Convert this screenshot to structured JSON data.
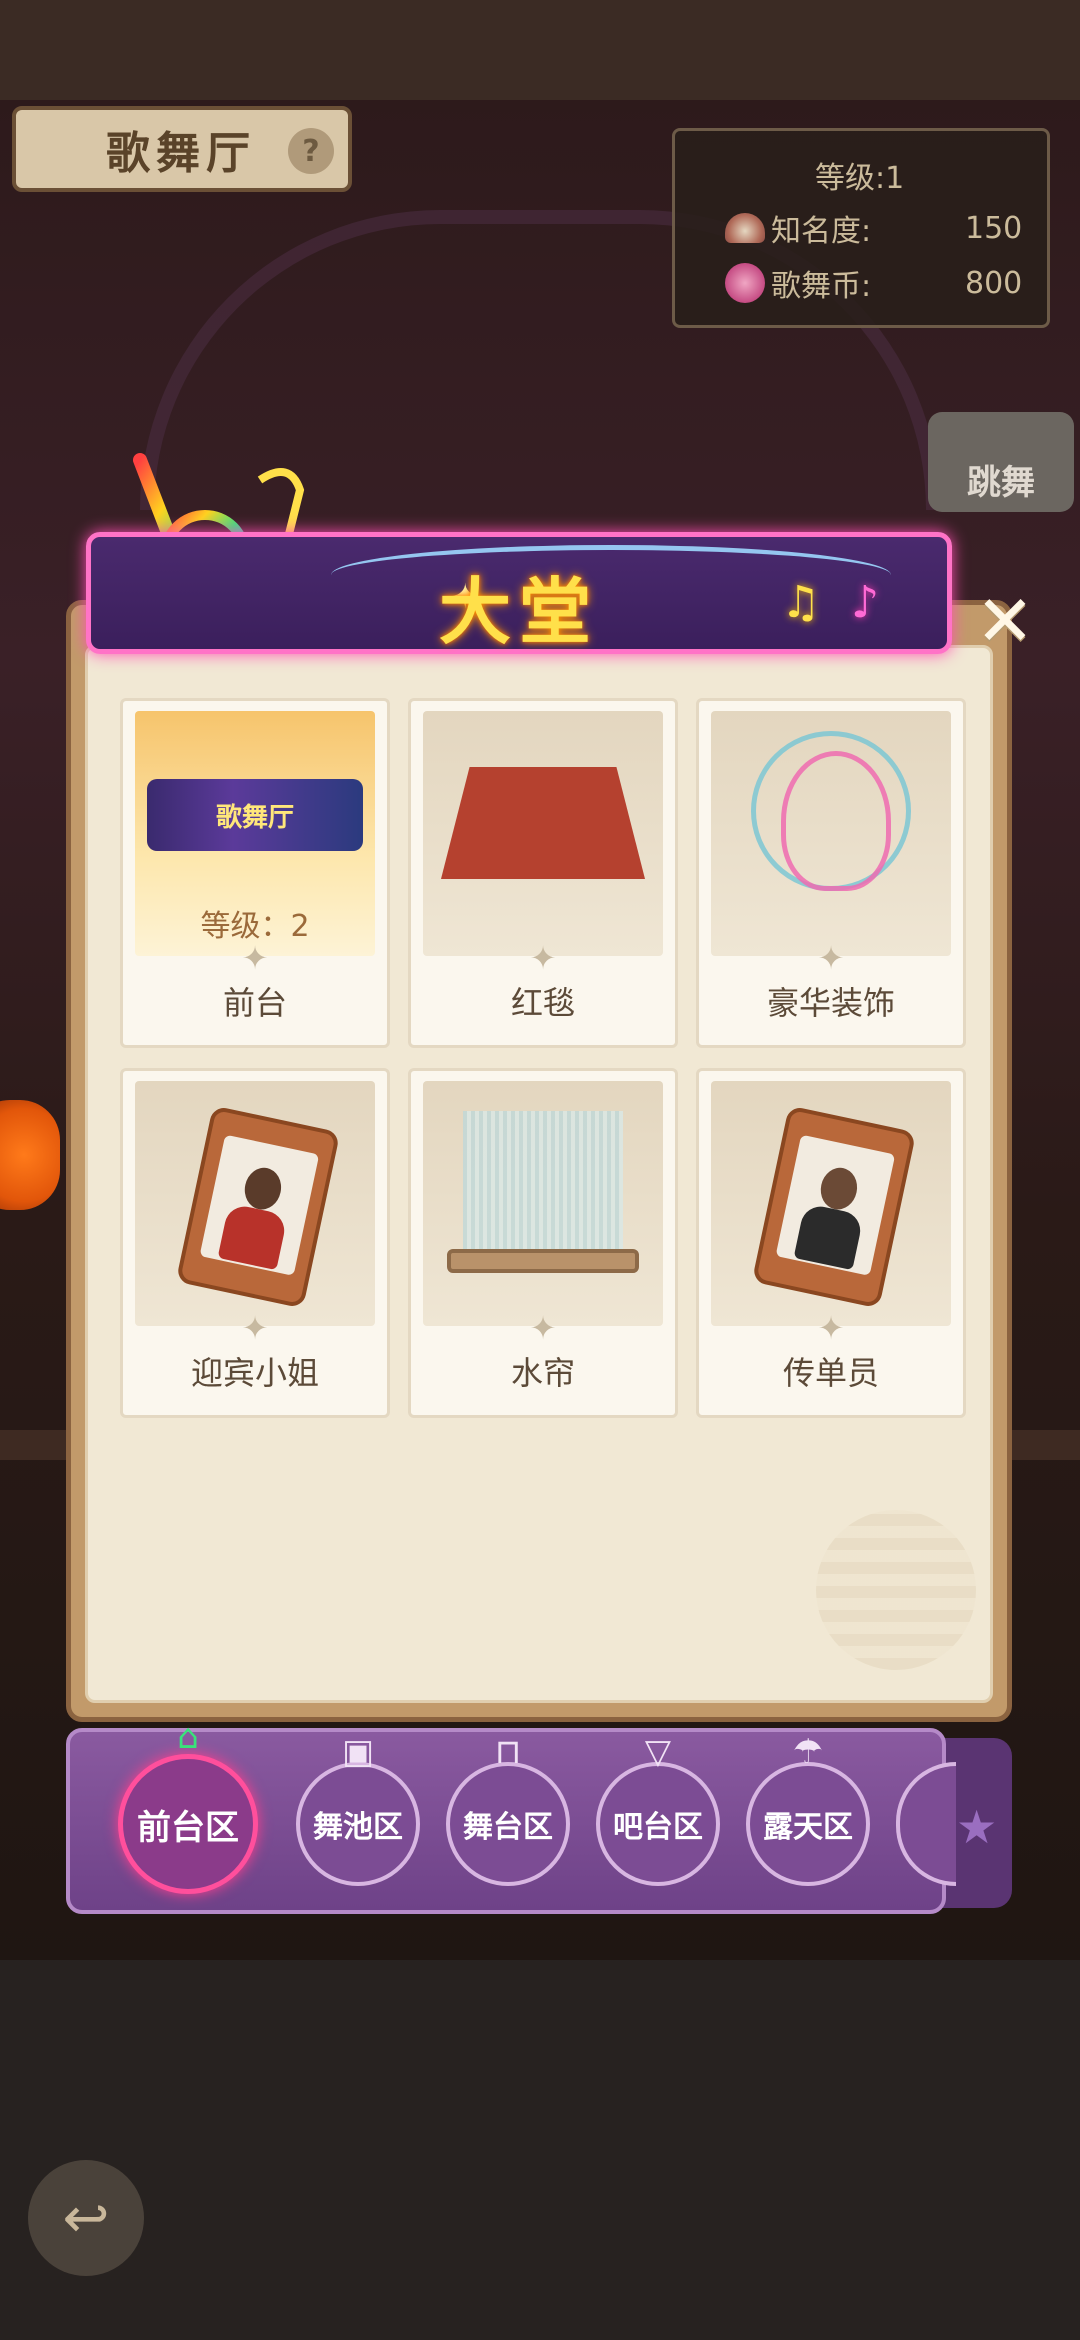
{
  "venue": {
    "title": "歌舞厅"
  },
  "stats": {
    "level_label": "等级:1",
    "fame_label": "知名度:",
    "fame_value": "150",
    "coin_label": "歌舞币:",
    "coin_value": "800"
  },
  "side_button": {
    "label": "跳舞"
  },
  "modal": {
    "title": "大堂",
    "items": [
      {
        "label": "前台",
        "level": "等级：2",
        "selected": true,
        "logo_text": "歌舞厅"
      },
      {
        "label": "红毯"
      },
      {
        "label": "豪华装饰"
      },
      {
        "label": "迎宾小姐"
      },
      {
        "label": "水帘"
      },
      {
        "label": "传单员"
      }
    ]
  },
  "tabs": [
    {
      "label": "前台区",
      "icon": "front-desk-icon",
      "active": true
    },
    {
      "label": "舞池区",
      "icon": "speaker-icon"
    },
    {
      "label": "舞台区",
      "icon": "curtain-icon"
    },
    {
      "label": "吧台区",
      "icon": "wine-glass-icon"
    },
    {
      "label": "露天区",
      "icon": "parasol-icon"
    }
  ],
  "colors": {
    "neon_pink": "#ff73c7",
    "title_yellow": "#ffe04a",
    "active_tab_ring": "#ff4f9c",
    "tab_bar": "#7c4c94"
  }
}
